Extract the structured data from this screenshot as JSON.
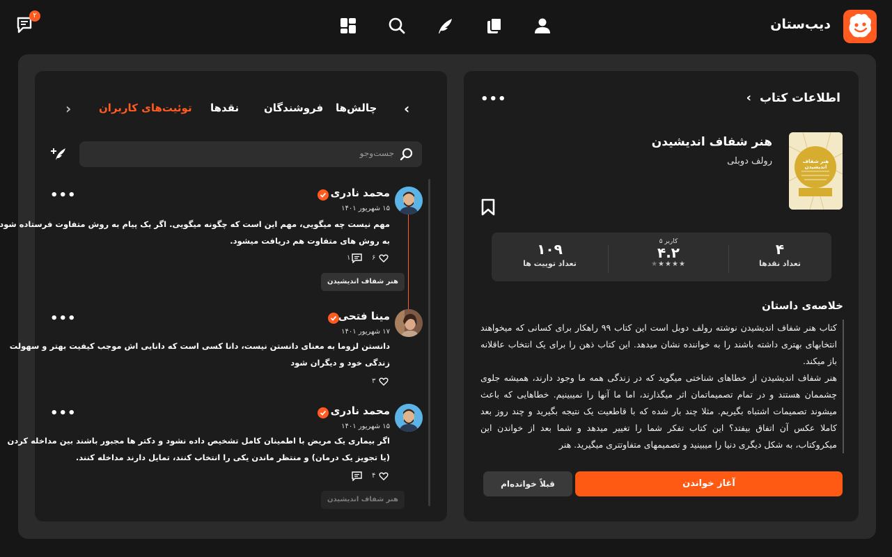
{
  "brand": {
    "name": "دیب‌ستان",
    "logo_icon": "smiling-face-logo",
    "accent": "#ff5a1f"
  },
  "nav": [
    {
      "icon": "user-icon"
    },
    {
      "icon": "book-library-icon"
    },
    {
      "icon": "feather-icon"
    },
    {
      "icon": "search-icon"
    },
    {
      "icon": "dashboard-grid-icon"
    }
  ],
  "messages": {
    "icon": "chat-icon",
    "badge": "۲"
  },
  "book": {
    "header": "اطلاعات کتاب",
    "title": "هنر شفاف اندیشیدن",
    "author": "رولف دوبلی",
    "cover_title": "هنر شفاف اندیشیدن",
    "stats": {
      "tweets_count": "۱۰۹",
      "tweets_label": "تعداد توییت ها",
      "rating_users": "۵ کاربر",
      "rating": "۴.۲",
      "rating_stars": 4,
      "reviews_count": "۴",
      "reviews_label": "تعداد نقدها"
    },
    "summary_title": "خلاصه‌ی داستان",
    "summary": "کتاب هنر شفاف اندیشیدن نوشته رولف دوبل است این کتاب ۹۹ راهکار برای کسانی که میخواهند انتخابهای بهتری داشته باشند را به خواننده نشان میدهد. این کتاب ذهن را برای یک انتخاب عاقلانه باز میکند.\nهنر شفاف اندیشیدن از خطاهای شناختی میگوید که در زندگی همه ما وجود دارند، همیشه جلوی چشممان هستند و در تمام تصمیماتمان اثر میگذارند، اما ما آنها را نمیبینیم. خطاهایی که باعث میشوند تصمیمات اشتباه بگیریم. مثلا چند بار شده که با قاطعیت یک نتیجه بگیرید و چند روز بعد کاملا عکس آن اتفاق بیفتد؟ این کتاب تفکر شما را تغییر میدهد و شما بعد از خواندن این میکروکتاب، به شکل دیگری دنیا را میبینید و تصمیمهای متفاوتتری میگیرید. هنر",
    "start_button": "آغاز خواندن",
    "read_button": "قبلاً خوانده‌ام"
  },
  "tabs": [
    "توئیت‌های کاربران",
    "نقدها",
    "فروشندگان",
    "چالش‌ها"
  ],
  "search": {
    "placeholder": "جست‌وجو"
  },
  "tweets": [
    {
      "name": "محمد نادری",
      "date": "۱۵ شهریور ۱۴۰۱",
      "lines": [
        "مهم نیست چه میگویی، مهم این است که چگونه میگویی. اگر یک پیام به روش متفاوت فرستاده شود،",
        "به روش های متفاوت هم دریافت میشود."
      ],
      "likes": "۶",
      "comments": "۱",
      "tag": "هنر شفاف اندیشیدن"
    },
    {
      "name": "مینا فتحی",
      "date": "۱۷ شهریور ۱۴۰۱",
      "lines": [
        "دانستن لزوما به معنای دانستن نیست، دانا کسی است که دانایی اش موجب کیفیت بهتر و سهولت",
        "زندگی خود و دیگران شود"
      ],
      "likes": "۳"
    },
    {
      "name": "محمد نادری",
      "date": "۱۵ شهریور ۱۴۰۱",
      "lines": [
        "اگر بیماری یک مریض با اطمینان کامل تشخیص داده نشود و دکتر ها مجبور باشند بین مداخله کردن",
        "(یا تجویز یک درمان) و منتظر ماندن یکی را انتخاب کنند، تمایل دارند مداخله کنند."
      ],
      "likes": "۴",
      "tag": "هنر شفاف اندیشیدن"
    }
  ]
}
